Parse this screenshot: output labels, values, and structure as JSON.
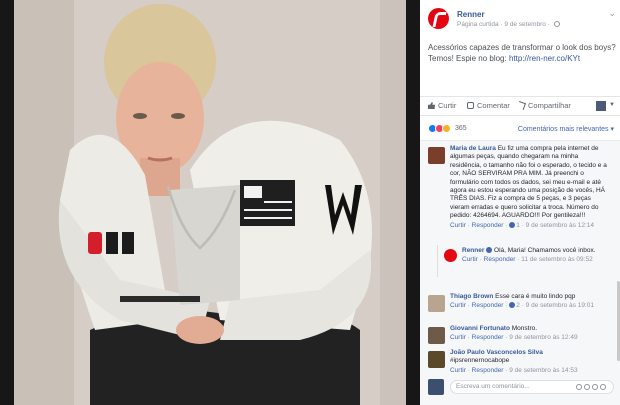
{
  "post": {
    "page_name": "Renner",
    "meta": "Página curtida · 9 de setembro ·",
    "text": "Acessórios capazes de transformar o look dos boys? Temos! Espie no blog:",
    "link": "http://ren-ner.co/KYt"
  },
  "actions": {
    "like": "Curtir",
    "comment": "Comentar",
    "share": "Compartilhar"
  },
  "reactions": {
    "count": "365",
    "filter": "Comentários mais relevantes ▾"
  },
  "comments": [
    {
      "name": "Maria de Laura",
      "text": "Eu fiz uma compra pela internet de algumas peças, quando chegaram na minha residência, o tamanho não foi o esperado, o tecido e a cor, NÃO SERVIRAM PRA MIM. Já preenchi o formulário com todos os dados, sei meu e-mail e até agora eu estou esperando uma posição de vocês, HÁ TRÊS DIAS. Fiz a compra de 5 peças, e 3 peças vieram erradas e quero solicitar a troca. Número do pedido: 4264694. AGUARDO!!! Por gentileza!!!",
      "like": "Curtir",
      "reply": "Responder",
      "likes": "1",
      "time": "9 de setembro às 12:14",
      "avatar_color": "#7a3f2a"
    },
    {
      "name": "Thiago Brown",
      "text": "Esse cara é muito lindo pqp",
      "like": "Curtir",
      "reply": "Responder",
      "likes": "2",
      "time": "9 de setembro às 19:01",
      "avatar_color": "#b9a58f"
    },
    {
      "name": "Giovanni Fortunato",
      "text": "Monstro.",
      "like": "Curtir",
      "reply": "Responder",
      "time": "9 de setembro às 12:49",
      "avatar_color": "#6e5a48"
    },
    {
      "name": "João Paulo Vasconcelos Silva",
      "text": "#ipsrennernocabope",
      "like": "Curtir",
      "reply": "Responder",
      "time": "9 de setembro às 14:53",
      "avatar_color": "#5a4a2a"
    }
  ],
  "reply": {
    "name": "Renner",
    "text": "Olá, Maria! Chamamos você inbox.",
    "like": "Curtir",
    "reply": "Responder",
    "time": "11 de setembro às 09:52"
  },
  "write_comment": {
    "placeholder": "Escreva um comentário..."
  },
  "colors": {
    "brand_red": "#e30613",
    "link_blue": "#365899"
  }
}
